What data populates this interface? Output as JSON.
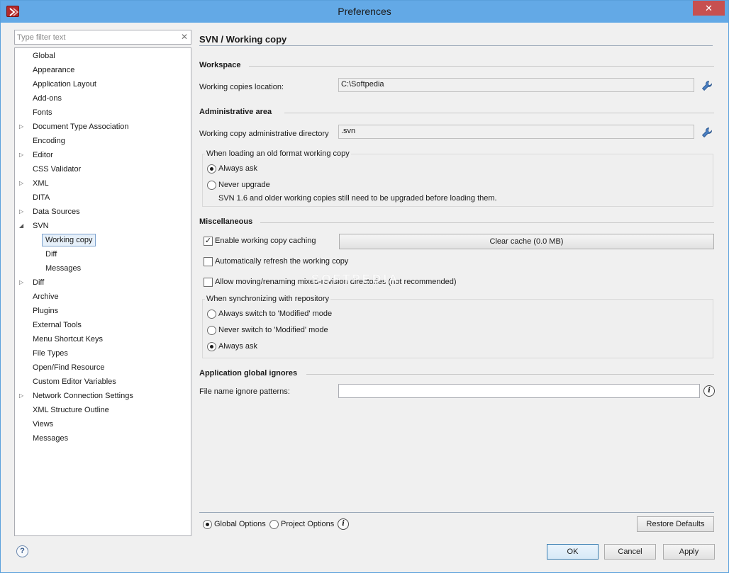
{
  "window": {
    "title": "Preferences",
    "close_glyph": "✕"
  },
  "filter": {
    "placeholder": "Type filter text",
    "clear_glyph": "✕"
  },
  "tree": {
    "items": [
      {
        "label": "Global",
        "expandable": false
      },
      {
        "label": "Appearance",
        "expandable": false
      },
      {
        "label": "Application Layout",
        "expandable": false
      },
      {
        "label": "Add-ons",
        "expandable": false
      },
      {
        "label": "Fonts",
        "expandable": false
      },
      {
        "label": "Document Type Association",
        "expandable": true
      },
      {
        "label": "Encoding",
        "expandable": false
      },
      {
        "label": "Editor",
        "expandable": true
      },
      {
        "label": "CSS Validator",
        "expandable": false
      },
      {
        "label": "XML",
        "expandable": true
      },
      {
        "label": "DITA",
        "expandable": false
      },
      {
        "label": "Data Sources",
        "expandable": true
      },
      {
        "label": "SVN",
        "expanded": true
      },
      {
        "label": "Working copy",
        "child": true,
        "selected": true
      },
      {
        "label": "Diff",
        "child": true
      },
      {
        "label": "Messages",
        "child": true
      },
      {
        "label": "Diff",
        "expandable": true
      },
      {
        "label": "Archive",
        "expandable": false
      },
      {
        "label": "Plugins",
        "expandable": false
      },
      {
        "label": "External Tools",
        "expandable": false
      },
      {
        "label": "Menu Shortcut Keys",
        "expandable": false
      },
      {
        "label": "File Types",
        "expandable": false
      },
      {
        "label": "Open/Find Resource",
        "expandable": false
      },
      {
        "label": "Custom Editor Variables",
        "expandable": false
      },
      {
        "label": "Network Connection Settings",
        "expandable": true
      },
      {
        "label": "XML Structure Outline",
        "expandable": false
      },
      {
        "label": "Views",
        "expandable": false
      },
      {
        "label": "Messages",
        "expandable": false
      }
    ]
  },
  "page": {
    "title": "SVN / Working copy",
    "workspace": {
      "title": "Workspace",
      "location_label": "Working copies location:",
      "location_value": "C:\\Softpedia"
    },
    "admin": {
      "title": "Administrative area",
      "dir_label": "Working copy administrative directory",
      "dir_value": ".svn",
      "group_caption": "When loading an old format working copy",
      "opt_always_ask": "Always ask",
      "opt_never_upgrade": "Never upgrade",
      "never_upgrade_note": "SVN 1.6 and older working copies still need to be upgraded before loading them."
    },
    "misc": {
      "title": "Miscellaneous",
      "enable_caching": "Enable working copy caching",
      "clear_cache": "Clear cache (0.0 MB)",
      "auto_refresh": "Automatically refresh the working copy",
      "allow_moving": "Allow moving/renaming mixed-revision directories (not recommended)",
      "sync_caption": "When synchronizing with repository",
      "sync_always_switch": "Always switch to 'Modified' mode",
      "sync_never_switch": "Never switch to 'Modified' mode",
      "sync_always_ask": "Always ask"
    },
    "ignores": {
      "title": "Application global ignores",
      "patterns_label": "File name ignore patterns:",
      "patterns_value": ""
    }
  },
  "scope": {
    "global": "Global Options",
    "project": "Project Options",
    "restore": "Restore Defaults"
  },
  "footer": {
    "ok": "OK",
    "cancel": "Cancel",
    "apply": "Apply",
    "help_glyph": "?"
  },
  "watermark": "SOFTPEDIA"
}
